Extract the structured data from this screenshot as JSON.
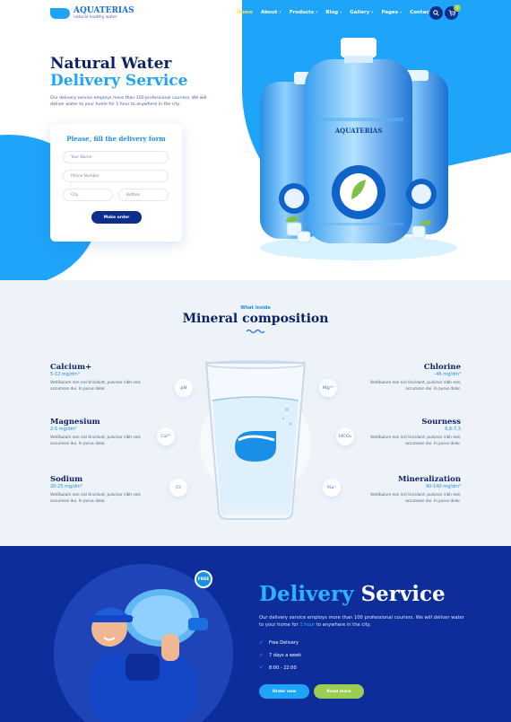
{
  "brand": {
    "name": "AQUATERIAS",
    "tagline": "natural healthy water"
  },
  "nav": {
    "items": [
      {
        "label": "Home",
        "active": true
      },
      {
        "label": "About ›"
      },
      {
        "label": "Products ›"
      },
      {
        "label": "Blog ›"
      },
      {
        "label": "Gallery ›"
      },
      {
        "label": "Pages ›"
      },
      {
        "label": "Contacts"
      }
    ],
    "search_icon": "search-icon",
    "cart_icon": "cart-icon",
    "cart_count": "0"
  },
  "hero": {
    "title_line1": "Natural Water",
    "title_line2": "Delivery Service",
    "description": "Our delivery service employs more than 100 professional couriers. We will deliver water to your home for 1 hour to anywhere in the city."
  },
  "form": {
    "title": "Please, fill the delivery form",
    "name_placeholder": "Your Name",
    "phone_placeholder": "Phone Number",
    "city_placeholder": "City",
    "bottles_placeholder": "Bottles",
    "submit": "Make order"
  },
  "product": {
    "label_text": "AQUATERIAS"
  },
  "minerals": {
    "kicker": "What inside",
    "title": "Mineral composition",
    "left": [
      {
        "name": "Calcium+",
        "value": "5-12 mg/dm³",
        "desc": "Vestibulum non nisi tincidunt, pulvinar nibh sed, accumsan dui. In purus dolor."
      },
      {
        "name": "Magnesium",
        "value": "2-5 mg/dm³",
        "desc": "Vestibulum non nisi tincidunt, pulvinar nibh sed, accumsan dui. In purus dolor."
      },
      {
        "name": "Sodium",
        "value": "20-25 mg/dm³",
        "desc": "Vestibulum non nisi tincidunt, pulvinar nibh sed, accumsan dui. In purus dolor."
      }
    ],
    "right": [
      {
        "name": "Chlorine",
        "value": "-46 mg/dm³",
        "desc": "Vestibulum non nisi tincidunt, pulvinar nibh sed, accumsan dui. In purus dolor."
      },
      {
        "name": "Sourness",
        "value": "6,6-7,3",
        "desc": "Vestibulum non nisi tincidunt, pulvinar nibh sed, accumsan dui. In purus dolor."
      },
      {
        "name": "Mineralization",
        "value": "90-140 mg/dm³",
        "desc": "Vestibulum non nisi tincidunt, pulvinar nibh sed, accumsan dui. In purus dolor."
      }
    ],
    "chem_left": [
      "pH",
      "Ca²⁺",
      "Cl"
    ],
    "chem_right": [
      "Mg²⁺",
      "HCO₃",
      "Na⁺"
    ]
  },
  "delivery": {
    "badge": "FREE",
    "title_a": "Delivery",
    "title_b": "Service",
    "desc_pre": "Our delivery service employs more than 100 professional couriers. We will deliver water to your home for",
    "desc_hl": "1 hour",
    "desc_post": "to anywhere in the city.",
    "features": [
      "Free Delivery",
      "7 days a week",
      "8:00 - 22:00"
    ],
    "btn_order": "Order now",
    "btn_more": "Read more"
  },
  "colors": {
    "navy": "#0d2166",
    "accent": "#1ea4f8",
    "delivery_bg": "#0d2e9a",
    "lime": "#9acd52"
  }
}
